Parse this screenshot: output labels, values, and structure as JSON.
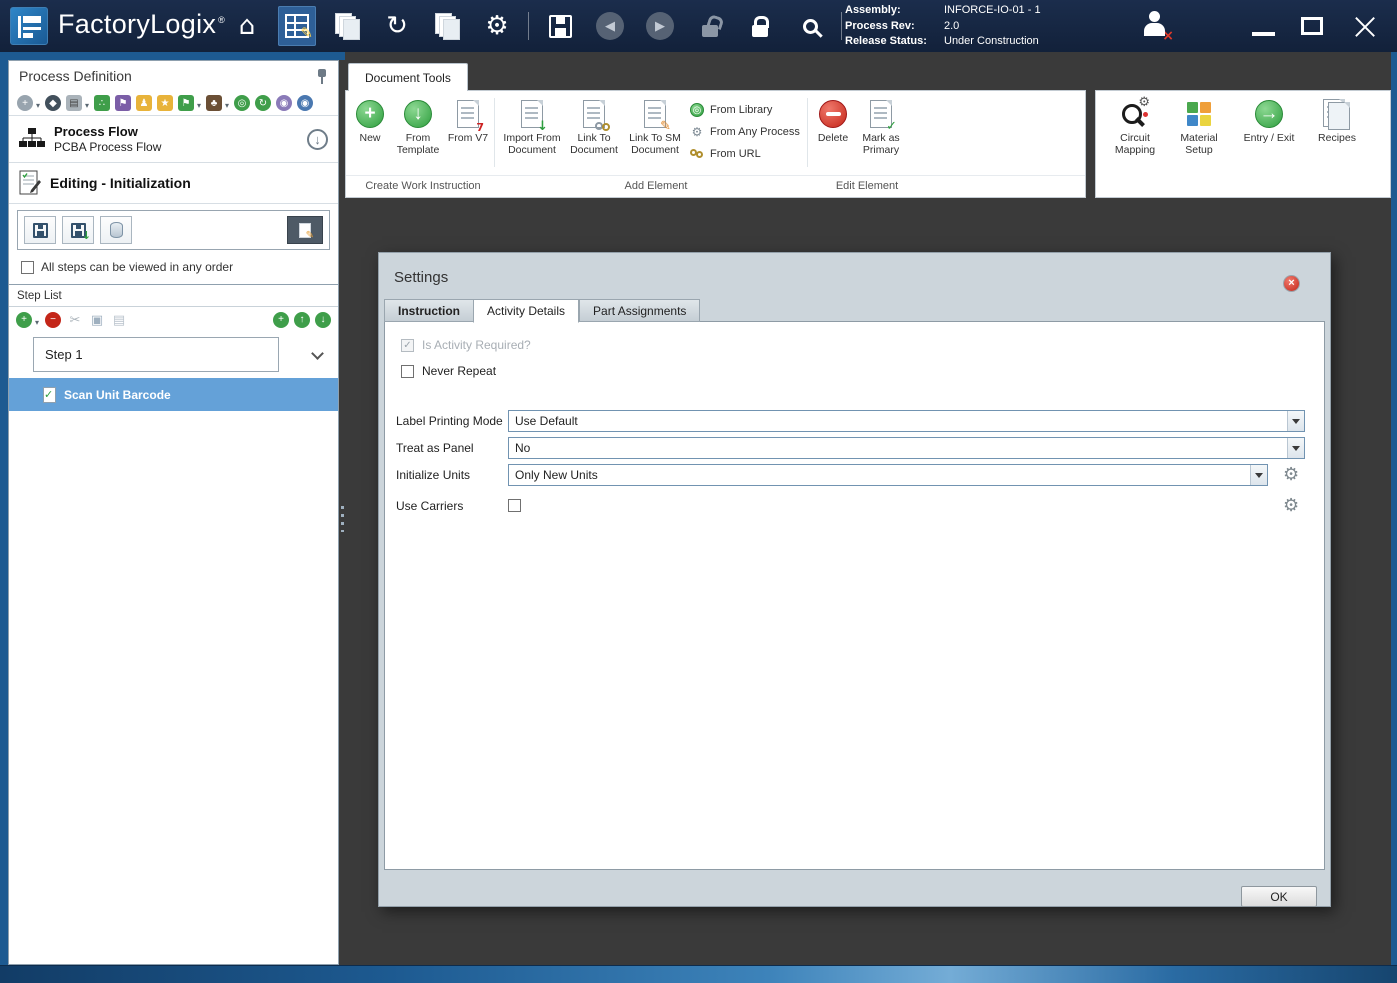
{
  "colors": {
    "titlebar_bg": "#15253f",
    "frame_blue": "#1d5a91",
    "canvas_dark": "#3a3a3a",
    "selection_blue": "#64a1d8",
    "accent_green": "#2e9e3e",
    "accent_red": "#c42619",
    "dialog_bg": "#ccd5db"
  },
  "titlebar": {
    "app_name": "FactoryLogix",
    "registered_mark": "®",
    "assembly_label": "Assembly:",
    "assembly_value": "INFORCE-IO-01 - 1",
    "process_rev_label": "Process Rev:",
    "process_rev_value": "2.0",
    "release_status_label": "Release Status:",
    "release_status_value": "Under Construction"
  },
  "left_panel": {
    "title": "Process Definition",
    "process_flow_title": "Process Flow",
    "process_flow_subtitle": "PCBA Process Flow",
    "editing_title": "Editing - Initialization",
    "any_order_label": "All steps can be viewed in any order",
    "step_list_title": "Step List",
    "step_group_label": "Step 1",
    "selected_step_label": "Scan Unit Barcode"
  },
  "ribbon": {
    "tab_label": "Document Tools",
    "create_group": {
      "label": "Create Work Instruction",
      "new": "New",
      "from_template": "From Template",
      "from_v7": "From V7"
    },
    "add_group": {
      "label": "Add Element",
      "import_from_document": "Import From Document",
      "link_to_document": "Link To Document",
      "link_to_sm_document": "Link To SM Document",
      "from_library": "From Library",
      "from_any_process": "From Any Process",
      "from_url": "From URL"
    },
    "edit_group": {
      "label": "Edit Element",
      "delete": "Delete",
      "mark_as_primary": "Mark as Primary"
    },
    "right_group": {
      "circuit_mapping": "Circuit Mapping",
      "material_setup": "Material Setup",
      "entry_exit": "Entry / Exit",
      "recipes": "Recipes"
    }
  },
  "dialog": {
    "title": "Settings",
    "tabs": [
      "Instruction",
      "Activity Details",
      "Part Assignments"
    ],
    "active_tab": "Activity Details",
    "is_activity_required_label": "Is Activity Required?",
    "never_repeat_label": "Never Repeat",
    "label_printing_mode_label": "Label Printing Mode",
    "label_printing_mode_value": "Use Default",
    "treat_as_panel_label": "Treat as Panel",
    "treat_as_panel_value": "No",
    "initialize_units_label": "Initialize Units",
    "initialize_units_value": "Only New Units",
    "use_carriers_label": "Use Carriers",
    "ok_label": "OK"
  },
  "icons": {
    "home": "⌂",
    "gear": "⚙",
    "sync": "↻",
    "back": "◀",
    "forward": "▶",
    "pencil": "✎",
    "plus": "+",
    "minus": "−",
    "down_arrow": "↓",
    "up_arrow": "↑",
    "right_arrow": "→",
    "check": "✓",
    "scissors": "✂",
    "star": "★",
    "flag": "⚑",
    "network": "∴",
    "tree": "♣",
    "person": "♟",
    "compass": "◆",
    "dot": "◉",
    "ring": "◎",
    "printer": "▤",
    "copy": "▣",
    "paste": "▤",
    "close": "×",
    "caret": "▾",
    "seven": "7"
  }
}
